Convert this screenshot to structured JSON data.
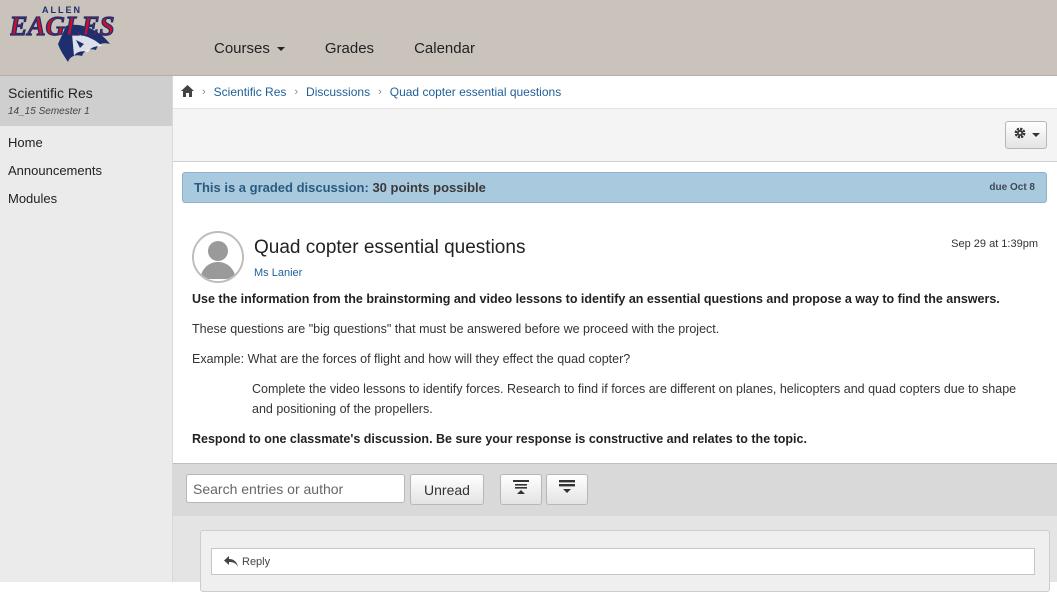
{
  "header": {
    "logo_text": "EAGLES",
    "logo_top_text": "ALLEN",
    "nav": [
      {
        "label": "Courses",
        "has_dropdown": true
      },
      {
        "label": "Grades"
      },
      {
        "label": "Calendar"
      }
    ]
  },
  "sidebar": {
    "course_name": "Scientific Res",
    "course_term": "14_15 Semester 1",
    "items": [
      {
        "label": "Home"
      },
      {
        "label": "Announcements"
      },
      {
        "label": "Modules"
      }
    ]
  },
  "breadcrumb": {
    "home_icon": "home-icon",
    "items": [
      "Scientific Res",
      "Discussions",
      "Quad copter essential questions"
    ]
  },
  "toolbar": {
    "settings_icon": "gear-icon"
  },
  "graded_banner": {
    "prefix": "This is a graded discussion:",
    "points": "30 points possible",
    "due": "due Oct 8"
  },
  "topic": {
    "title": "Quad copter essential questions",
    "author": "Ms Lanier",
    "date": "Sep 29 at 1:39pm",
    "paragraphs": [
      "Use the information from the brainstorming and video lessons to identify an essential questions and propose a way to find the answers.",
      "These questions are \"big questions\" that must be answered before we proceed with the project.",
      "Example: What are the forces of flight and how will they effect the quad copter?",
      "Complete the video lessons to identify forces. Research to find if forces are different on planes, helicopters and quad copters due to shape and positioning of the propellers.",
      "Respond to one classmate's discussion. Be sure your response is constructive and relates to the topic."
    ]
  },
  "entries": {
    "search_placeholder": "Search entries or author",
    "unread_label": "Unread",
    "collapse_icon": "collapse-replies-icon",
    "expand_icon": "expand-replies-icon",
    "reply_label": "Reply",
    "reply_icon": "reply-arrow-icon"
  },
  "colors": {
    "header_bg": "#c9c3bb",
    "banner_bg": "#a9c9de",
    "link": "#1f5f99",
    "logo_red": "#c8102e",
    "logo_blue": "#1d2f6f"
  }
}
